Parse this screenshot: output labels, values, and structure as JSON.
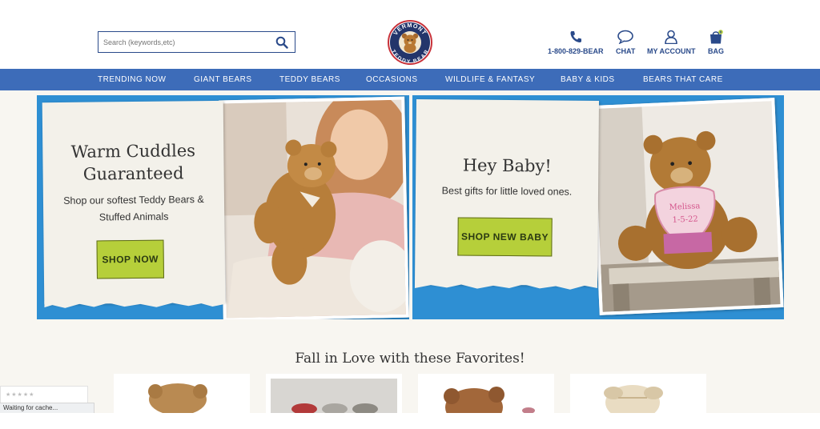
{
  "header": {
    "search_placeholder": "Search (keywords,etc)",
    "logo_text_top": "VERMONT",
    "logo_text_bottom": "TEDDY BEAR",
    "links": [
      {
        "label": "1-800-829-BEAR",
        "icon": "phone-icon"
      },
      {
        "label": "CHAT",
        "icon": "chat-icon"
      },
      {
        "label": "MY ACCOUNT",
        "icon": "account-icon"
      },
      {
        "label": "BAG",
        "icon": "bag-icon",
        "count": "0"
      }
    ]
  },
  "nav": {
    "items": [
      "TRENDING NOW",
      "GIANT BEARS",
      "TEDDY BEARS",
      "OCCASIONS",
      "WILDLIFE & FANTASY",
      "BABY & KIDS",
      "BEARS THAT CARE"
    ]
  },
  "hero": [
    {
      "title_line1": "Warm Cuddles",
      "title_line2": "Guaranteed",
      "text_line1": "Shop our softest Teddy Bears &",
      "text_line2": "Stuffed Animals",
      "cta": "SHOP NOW"
    },
    {
      "title": "Hey Baby!",
      "text": "Best gifts for little loved ones.",
      "cta": "SHOP NEW BABY",
      "bib_name": "Melissa",
      "bib_date": "1-5-22"
    }
  ],
  "favorites": {
    "title": "Fall in Love with these Favorites!"
  },
  "status_bar": {
    "text": "Waiting for cache..."
  },
  "colors": {
    "nav_blue": "#3d6cb9",
    "hero_blue": "#2e8fd3",
    "cta_green": "#b6cf3a",
    "brand_navy": "#2a4a8a"
  }
}
